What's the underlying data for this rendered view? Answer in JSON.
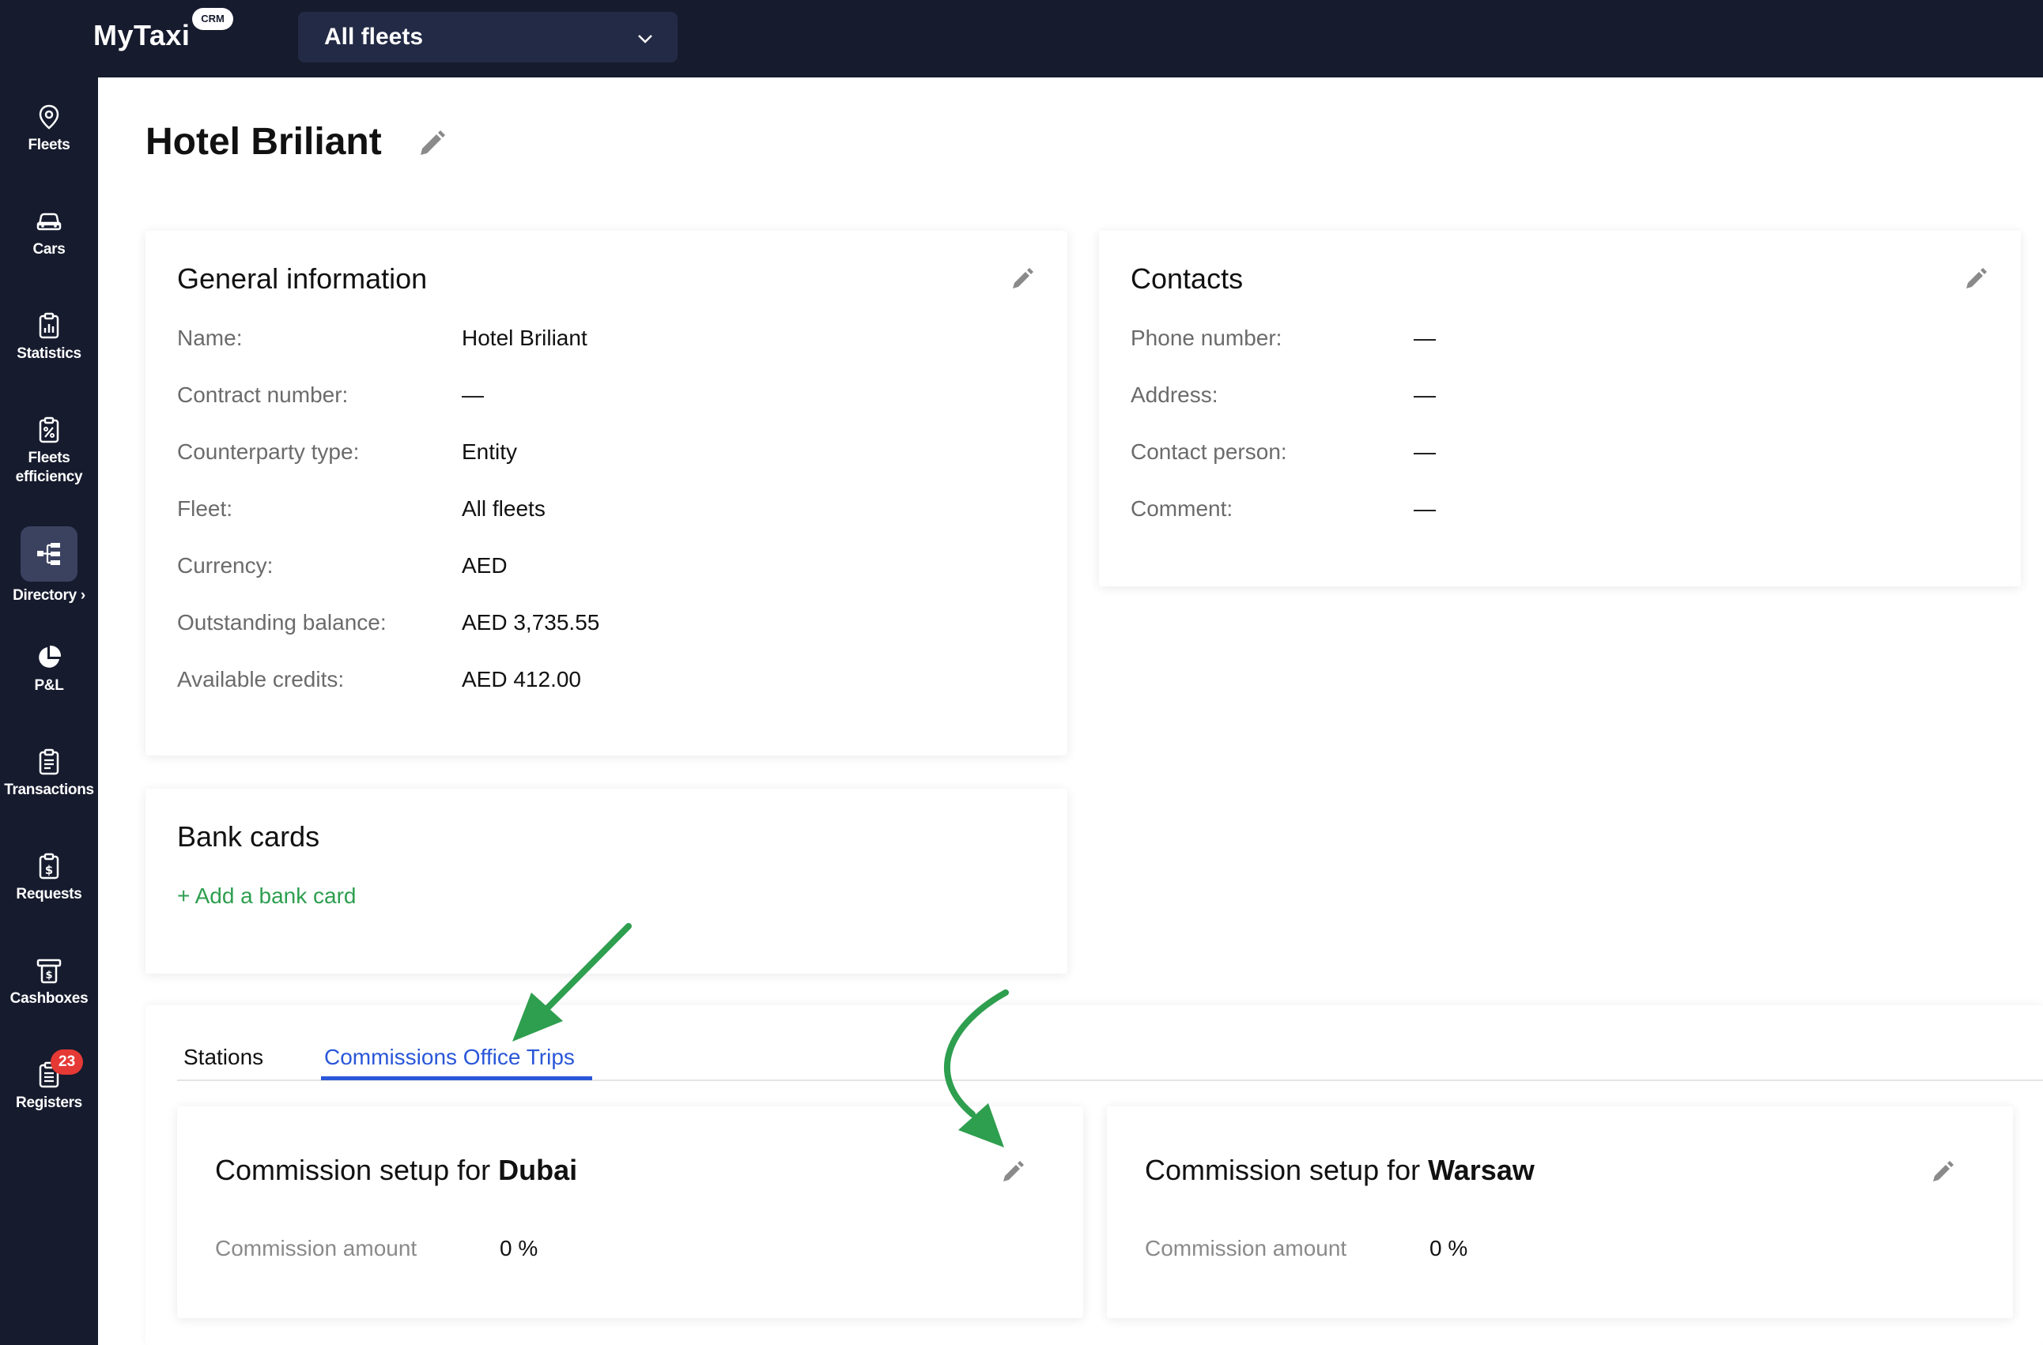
{
  "app": {
    "logo": "MyTaxi",
    "logo_badge": "CRM"
  },
  "topbar": {
    "fleet_select_value": "All fleets"
  },
  "sidebar": {
    "items": [
      {
        "label": "Fleets",
        "icon": "location-pin-icon"
      },
      {
        "label": "Cars",
        "icon": "car-icon"
      },
      {
        "label": "Statistics",
        "icon": "clipboard-chart-icon"
      },
      {
        "label": "Fleets efficiency",
        "icon": "clipboard-percent-icon"
      },
      {
        "label": "Directory ›",
        "icon": "hierarchy-icon",
        "active": true
      },
      {
        "label": "P&L",
        "icon": "pie-chart-icon"
      },
      {
        "label": "Transactions",
        "icon": "clipboard-list-icon"
      },
      {
        "label": "Requests",
        "icon": "clipboard-dollar-icon"
      },
      {
        "label": "Cashboxes",
        "icon": "cash-register-icon"
      },
      {
        "label": "Registers",
        "icon": "clipboard-doc-icon",
        "badge": "23"
      }
    ]
  },
  "page": {
    "title": "Hotel Briliant"
  },
  "general": {
    "title": "General information",
    "rows": [
      {
        "label": "Name:",
        "value": "Hotel Briliant"
      },
      {
        "label": "Contract number:",
        "value": "—"
      },
      {
        "label": "Counterparty type:",
        "value": "Entity"
      },
      {
        "label": "Fleet:",
        "value": "All fleets"
      },
      {
        "label": "Currency:",
        "value": "AED"
      },
      {
        "label": "Outstanding balance:",
        "value": "AED 3,735.55"
      },
      {
        "label": "Available credits:",
        "value": "AED 412.00"
      }
    ]
  },
  "contacts": {
    "title": "Contacts",
    "rows": [
      {
        "label": "Phone number:",
        "value": "—"
      },
      {
        "label": "Address:",
        "value": "—"
      },
      {
        "label": "Contact person:",
        "value": "—"
      },
      {
        "label": "Comment:",
        "value": "—"
      }
    ]
  },
  "bank_cards": {
    "title": "Bank cards",
    "add_label": "+ Add a bank card"
  },
  "tabs": [
    {
      "label": "Stations",
      "active": false
    },
    {
      "label": "Commissions Office Trips",
      "active": true
    }
  ],
  "commissions": [
    {
      "prefix": "Commission setup for ",
      "city": "Dubai",
      "amount_label": "Commission amount",
      "amount_value": "0 %"
    },
    {
      "prefix": "Commission setup for ",
      "city": "Warsaw",
      "amount_label": "Commission amount",
      "amount_value": "0 %"
    }
  ],
  "colors": {
    "nav_bg": "#161b2e",
    "accent_blue": "#2a57d8",
    "link_green": "#2e9e4f",
    "badge_red": "#e53935",
    "annotation_arrow": "#2e9e4f"
  }
}
